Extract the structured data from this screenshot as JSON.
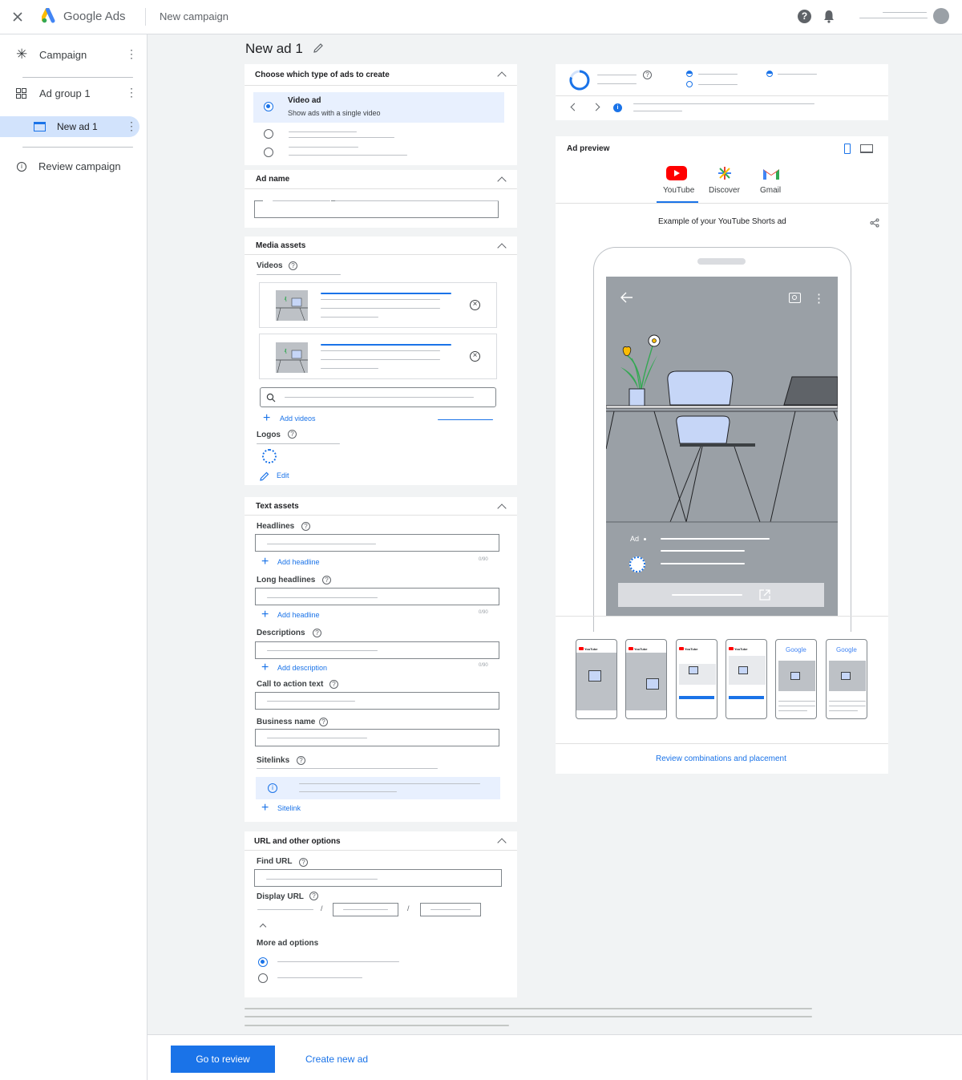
{
  "topbar": {
    "brand": "Google Ads",
    "page": "New campaign"
  },
  "sidebar": {
    "items": [
      {
        "label": "Campaign"
      },
      {
        "label": "Ad group 1"
      },
      {
        "label": "New ad 1"
      },
      {
        "label": "Review campaign"
      }
    ]
  },
  "main": {
    "title": "New ad 1",
    "ad_type": {
      "title": "Choose which type of ads to create",
      "option_title": "Video ad",
      "option_desc": "Show ads with a single video"
    },
    "ad_name": {
      "title": "Ad name"
    },
    "media": {
      "title": "Media assets",
      "videos": "Videos",
      "add_videos": "Add videos",
      "logos": "Logos",
      "edit": "Edit"
    },
    "text_assets": {
      "title": "Text assets",
      "headlines": "Headlines",
      "add_headline": "Add headline",
      "long_headlines": "Long headlines",
      "add_long_headline": "Add headline",
      "descriptions": "Descriptions",
      "add_description": "Add description",
      "counter": "0/90",
      "cta": "Call to action text",
      "business": "Business name",
      "sitelinks": "Sitelinks",
      "add_sitelink": "Sitelink"
    },
    "url": {
      "title": "URL and other options",
      "final_url": "Find URL",
      "display_url": "Display URL",
      "slash": "/",
      "more": "More ad options"
    }
  },
  "preview": {
    "title": "Ad preview",
    "tabs": [
      {
        "label": "YouTube"
      },
      {
        "label": "Discover"
      },
      {
        "label": "Gmail"
      }
    ],
    "example": "Example of your YouTube Shorts ad",
    "ad_label": "Ad",
    "thumb_brand_yt": "YouTube",
    "thumb_brand_g": "Google",
    "review_link": "Review combinations and placement"
  },
  "footer": {
    "primary": "Go to review",
    "secondary": "Create new ad"
  },
  "colors": {
    "accent": "#1a73e8",
    "selected_bg": "#e8f0fe",
    "phone_bg": "#9aa0a6"
  }
}
